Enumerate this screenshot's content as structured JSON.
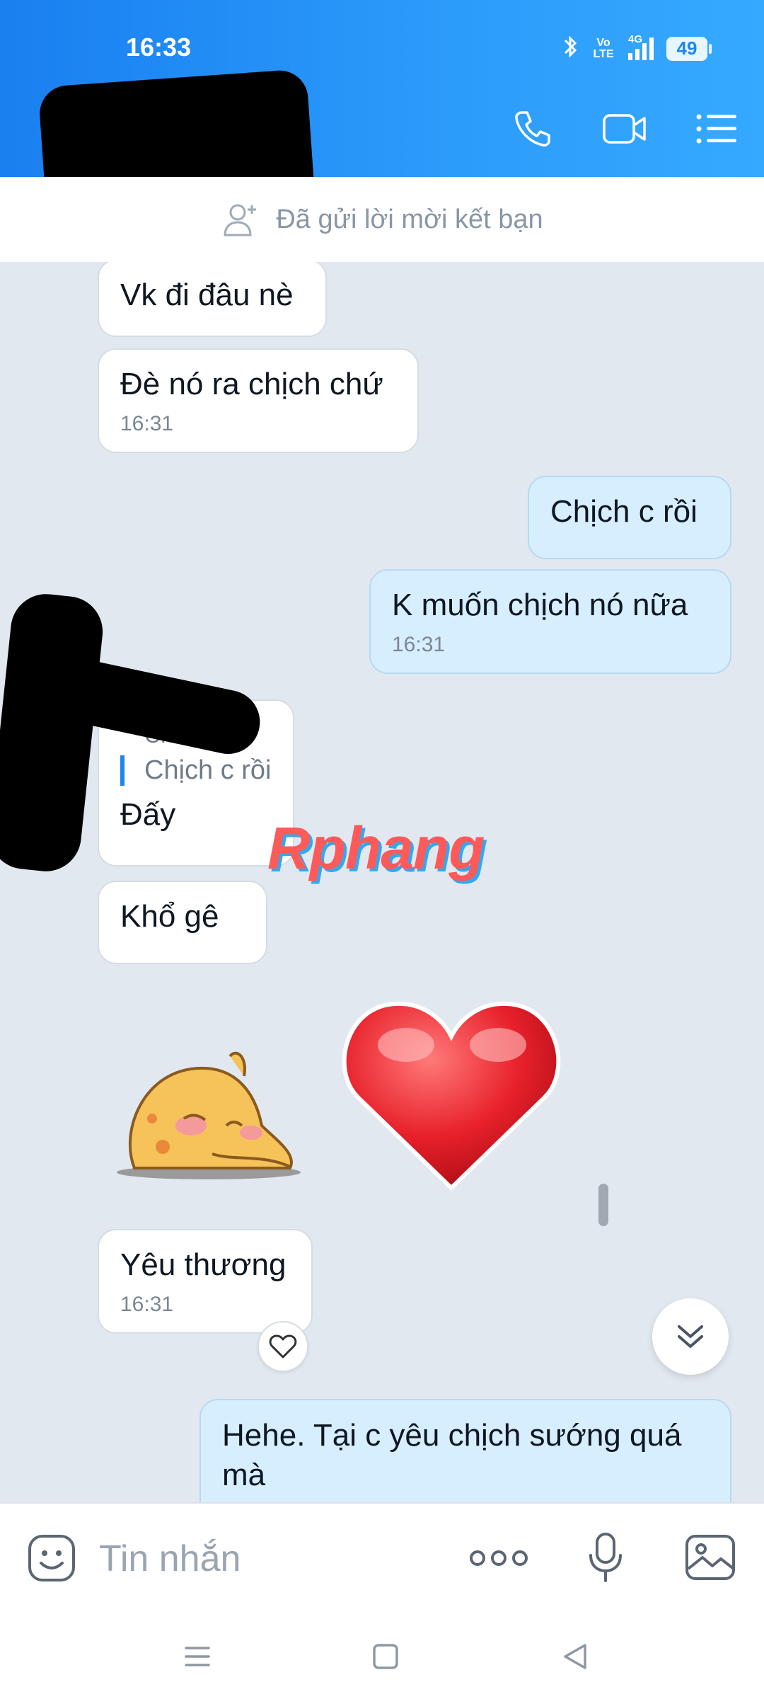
{
  "status_bar": {
    "time": "16:33",
    "volte": "Vo LTE",
    "signal_label": "4G",
    "battery": "49",
    "icons": [
      "bluetooth-icon",
      "volte-icon",
      "signal-icon",
      "battery-icon"
    ]
  },
  "header": {
    "contact_name": "",
    "icons": [
      "back-arrow-icon",
      "phone-icon",
      "video-call-icon",
      "list-icon"
    ]
  },
  "friend_request": {
    "label": "Đã gửi lời mời kết bạn",
    "icon": "add-user-icon"
  },
  "messages": [
    {
      "side": "in",
      "text": "Vk đi đâu nè",
      "time": ""
    },
    {
      "side": "in",
      "text": "Đè nó ra chịch chứ",
      "time": "16:31"
    },
    {
      "side": "out",
      "text": "Chịch c rồi",
      "time": ""
    },
    {
      "side": "out",
      "text": "K muốn chịch nó nữa",
      "time": "16:31"
    },
    {
      "side": "in",
      "quote_name": "Chi",
      "quote": "Chịch c rồi",
      "text": "Đấy",
      "time": ""
    },
    {
      "side": "in",
      "text": "Khổ gê",
      "time": ""
    },
    {
      "side": "in",
      "text": "Yêu thương",
      "time": "16:31",
      "reaction": "heart-icon"
    },
    {
      "side": "out",
      "text": "Hehe. Tại c yêu chịch sướng quá mà",
      "time": ""
    }
  ],
  "stickers": [
    "sleeping-cat-sticker",
    "red-heart-sticker"
  ],
  "watermark": "Rphang",
  "composer": {
    "placeholder": "Tin nhắn",
    "icons": [
      "sticker-icon",
      "more-icon",
      "microphone-icon",
      "image-icon"
    ]
  },
  "nav": {
    "icons": [
      "menu-icon",
      "home-icon",
      "back-icon"
    ]
  },
  "colors": {
    "header_start": "#1a7ff0",
    "header_end": "#35a9ff",
    "chat_bg": "#e2e8f0",
    "out_bubble": "#d6eefd",
    "in_bubble": "#ffffff",
    "accent": "#1d86f0"
  }
}
